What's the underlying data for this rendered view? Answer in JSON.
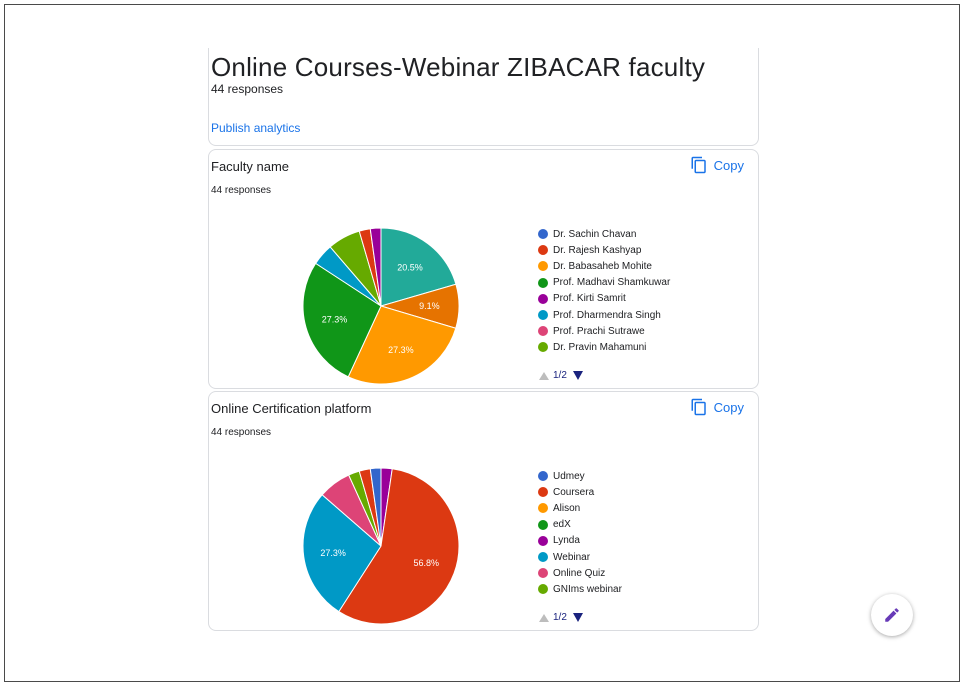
{
  "form": {
    "title": "Online Courses-Webinar ZIBACAR faculty",
    "responses": "44 responses",
    "publish_label": "Publish analytics"
  },
  "copy_label": "Copy",
  "questions": [
    {
      "title": "Faculty name",
      "responses": "44 responses",
      "pager": "1/2",
      "legend": [
        {
          "name": "Dr. Sachin Chavan",
          "color": "#3366cc"
        },
        {
          "name": "Dr. Rajesh Kashyap",
          "color": "#dc3912"
        },
        {
          "name": "Dr. Babasaheb Mohite",
          "color": "#ff9900"
        },
        {
          "name": "Prof. Madhavi Shamkuwar",
          "color": "#109618"
        },
        {
          "name": "Prof. Kirti Samrit",
          "color": "#990099"
        },
        {
          "name": "Prof. Dharmendra Singh",
          "color": "#0099c6"
        },
        {
          "name": "Prof. Prachi Sutrawe",
          "color": "#dd4477"
        },
        {
          "name": "Dr. Pravin Mahamuni",
          "color": "#66aa00"
        }
      ]
    },
    {
      "title": "Online Certification platform",
      "responses": "44 responses",
      "pager": "1/2",
      "legend": [
        {
          "name": "Udmey",
          "color": "#3366cc"
        },
        {
          "name": "Coursera",
          "color": "#dc3912"
        },
        {
          "name": "Alison",
          "color": "#ff9900"
        },
        {
          "name": "edX",
          "color": "#109618"
        },
        {
          "name": "Lynda",
          "color": "#990099"
        },
        {
          "name": "Webinar",
          "color": "#0099c6"
        },
        {
          "name": "Online Quiz",
          "color": "#dd4477"
        },
        {
          "name": "GNIms webinar",
          "color": "#66aa00"
        }
      ]
    }
  ],
  "chart_data": [
    {
      "type": "pie",
      "slices": [
        {
          "value": 20.5,
          "color": "#22aa99",
          "label": "20.5%"
        },
        {
          "value": 9.1,
          "color": "#e67300",
          "label": "9.1%"
        },
        {
          "value": 27.3,
          "color": "#ff9900",
          "label": "27.3%"
        },
        {
          "value": 27.3,
          "color": "#109618",
          "label": "27.3%"
        },
        {
          "value": 4.5,
          "color": "#0099c6",
          "label": ""
        },
        {
          "value": 6.8,
          "color": "#66aa00",
          "label": ""
        },
        {
          "value": 2.3,
          "color": "#dc3912",
          "label": ""
        },
        {
          "value": 2.2,
          "color": "#990099",
          "label": ""
        }
      ]
    },
    {
      "type": "pie",
      "slices": [
        {
          "value": 2.3,
          "color": "#990099",
          "label": ""
        },
        {
          "value": 56.8,
          "color": "#dc3912",
          "label": "56.8%"
        },
        {
          "value": 27.3,
          "color": "#0099c6",
          "label": "27.3%"
        },
        {
          "value": 6.8,
          "color": "#dd4477",
          "label": ""
        },
        {
          "value": 2.3,
          "color": "#66aa00",
          "label": ""
        },
        {
          "value": 2.3,
          "color": "#dc3912",
          "label": ""
        },
        {
          "value": 2.2,
          "color": "#3366cc",
          "label": ""
        }
      ]
    }
  ]
}
